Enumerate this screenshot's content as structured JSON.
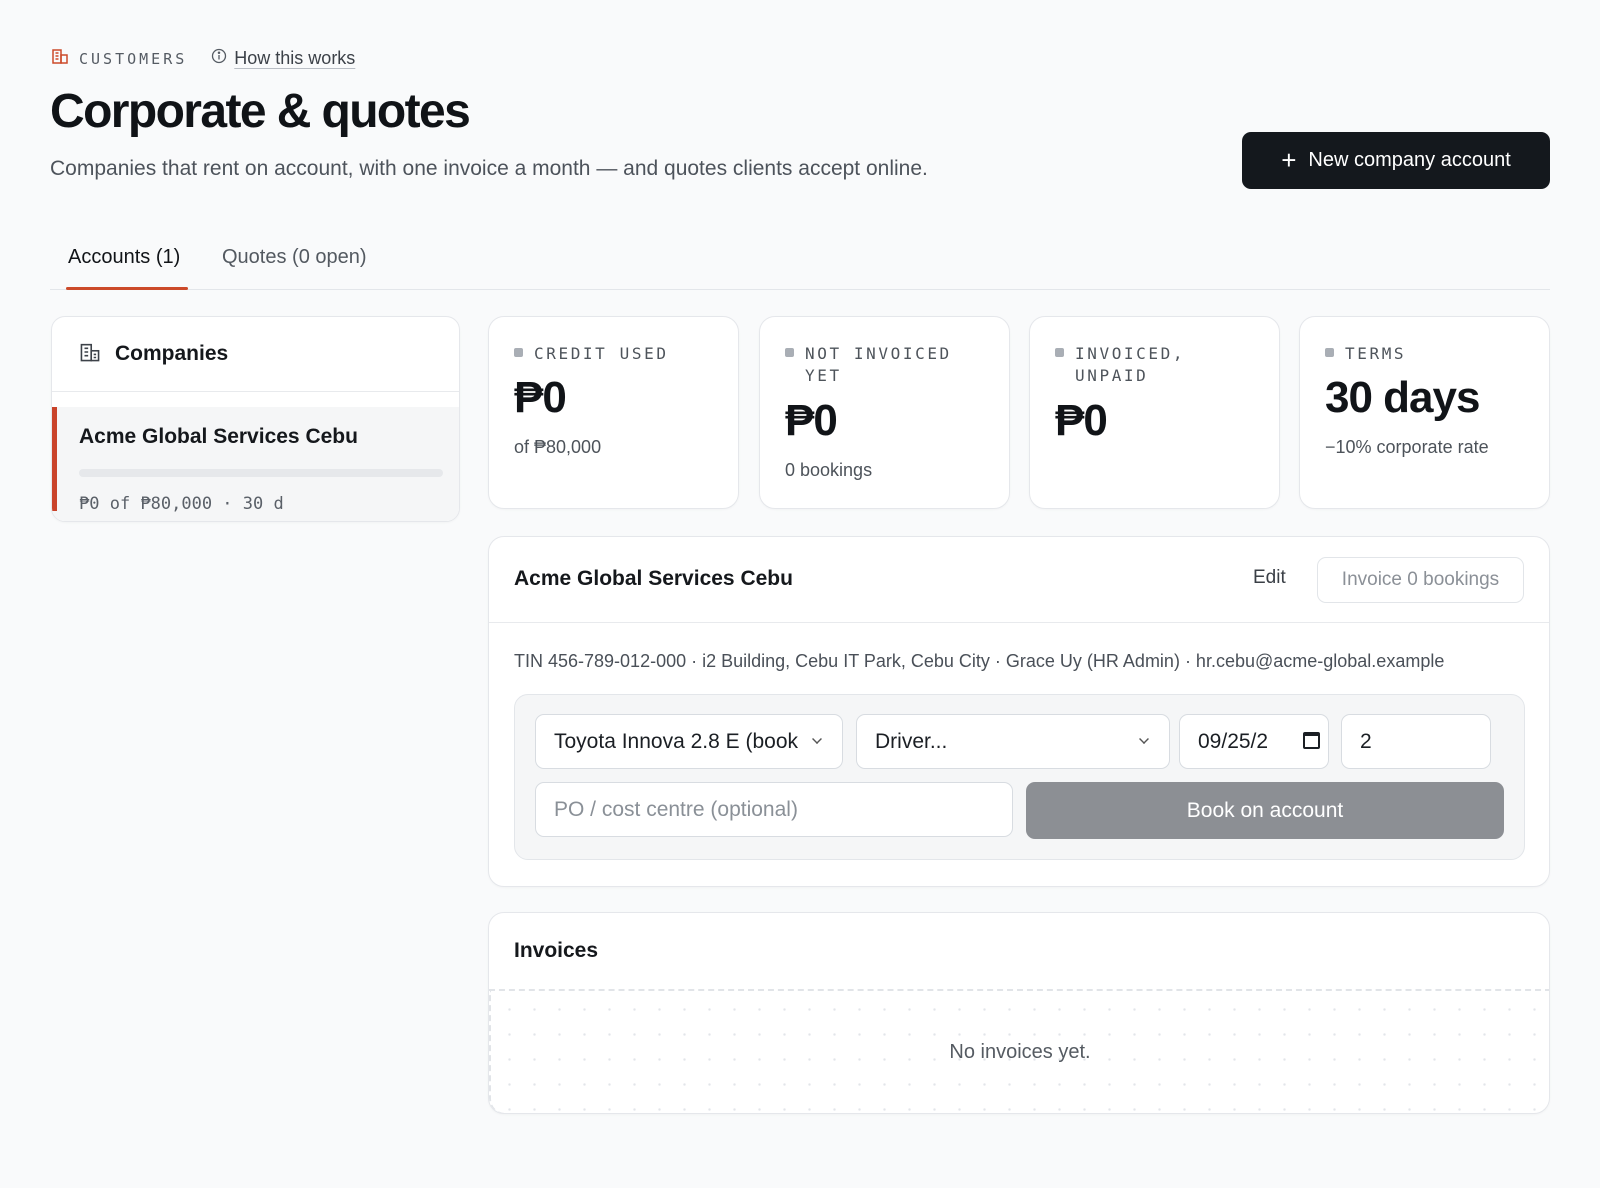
{
  "header": {
    "eyebrow": "CUSTOMERS",
    "help_link": "How this works",
    "title": "Corporate & quotes",
    "subtitle": "Companies that rent on account, with one invoice a month — and quotes clients accept online.",
    "new_button": "New company account"
  },
  "tabs": [
    {
      "label": "Accounts (1)",
      "active": true
    },
    {
      "label": "Quotes (0 open)",
      "active": false
    }
  ],
  "companies": {
    "title": "Companies",
    "items": [
      {
        "name": "Acme Global Services Cebu",
        "meta": "₱0 of ₱80,000 · 30 d",
        "credit_used_fraction": 0
      }
    ]
  },
  "stats": [
    {
      "label": "CREDIT USED",
      "value": "₱0",
      "sub": "of ₱80,000"
    },
    {
      "label": "NOT INVOICED YET",
      "value": "₱0",
      "sub": "0 bookings"
    },
    {
      "label": "INVOICED, UNPAID",
      "value": "₱0",
      "sub": ""
    },
    {
      "label": "TERMS",
      "value": "30 days",
      "sub": "−10% corporate rate"
    }
  ],
  "account": {
    "name": "Acme Global Services Cebu",
    "edit_label": "Edit",
    "invoice_label": "Invoice 0 bookings",
    "info": "TIN 456-789-012-000 · i2 Building, Cebu IT Park, Cebu City · Grace Uy (HR Admin) · hr.cebu@acme-global.example",
    "booking": {
      "vehicle": "Toyota Innova 2.8 E (book",
      "driver": "Driver...",
      "date": "09/25/2",
      "days": "2",
      "po_placeholder": "PO / cost centre (optional)",
      "book_label": "Book on account"
    }
  },
  "invoices": {
    "title": "Invoices",
    "empty_text": "No invoices yet."
  },
  "colors": {
    "accent": "#cc4a2a",
    "primary_button": "#14181d",
    "disabled_button": "#8c8f94"
  }
}
